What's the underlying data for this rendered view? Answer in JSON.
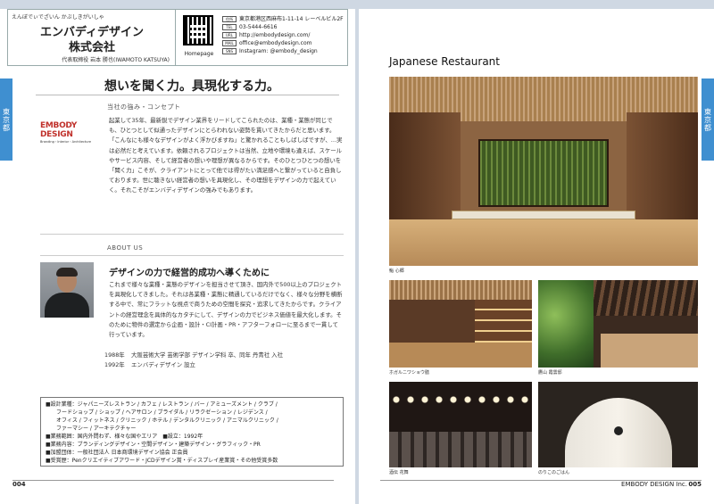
{
  "left_page": {
    "header": {
      "kana": "えんぼでぃでざいん かぶしきがいしゃ",
      "company_line1": "エンバディデザイン",
      "company_line2": "株式会社",
      "representative": "代表取締役 岩本 勝也(IWAMOTO KATSUYA)",
      "homepage_label": "Homepage",
      "contact": [
        {
          "tag": "住所",
          "value": "東京都港区西麻布1-11-14 レーベルビル2F"
        },
        {
          "tag": "TEL",
          "value": "03-5444-6616"
        },
        {
          "tag": "URL",
          "value": "http://embodydesign.com/"
        },
        {
          "tag": "MAIL",
          "value": "office@embodydesign.com"
        },
        {
          "tag": "SNS",
          "value": "Instagram: @embody_design"
        }
      ]
    },
    "side_tab": "東京都",
    "catchcopy": "想いを聞く力。具現化する力。",
    "strength_label": "当社の強み・コンセプト",
    "logo": {
      "main": "EMBODY DESIGN",
      "sub": "Branding・Interior・Architecture"
    },
    "strength_text": "起業して35年、最新鋭でデザイン業界をリードしてこられたのは、業種・業態が同じでも、ひとつとして似通ったデザインにとらわれない姿勢を貫いてきたからだと思います。「こんなにも様々なデザインがよく浮かびますね」と驚かれることもしばしばですが、…実は必然だと考えています。依頼されるプロジェクトは当然、立地や環境も違えば、スケールやサービス内容、そして経営者の想いや理想が異なるからです。そのひとつひとつの想いを「聞く力」こそが、クライアントにとって他では得がたい満足感へと繋がっていると自負しております。世に聴きない経営者の想いを具現化し、その理想をデザインの力で起えていく。それこそがエンバディデザインの強みでもあります。",
    "about_label": "ABOUT US",
    "about_heading": "デザインの力で経営的成功へ導くために",
    "about_text": "これまで様々な業種・業態のデザインを担当させて頂き、国内外で500以上のプロジェクトを具現化してきました。それは各業種・業態に精通しているだけでなく、様々な分野を横断する中で、常にフラットな視点で商うための空間を探究・追求してきたからです。クライアントの経営理念を具体的なカタチにして、デザインの力でビジネス価値を最大化します。そのために物件の選定から企画・設計・CI計画・PR・アフターフォローに至るまで一貫して行っています。",
    "career": [
      {
        "year": "1988年",
        "text": "大阪芸術大学 芸術学部 デザイン学科 卒、同年 丹青社 入社"
      },
      {
        "year": "1992年",
        "text": "エンバディデザイン 設立"
      }
    ],
    "info": [
      "■設計業種：ジャパニーズレストラン / カフェ / レストラン / バー / アミューズメント / クラブ /",
      "　　フードショップ / ショップ / ヘアサロン / ブライダル / リラクゼーション / レジデンス /",
      "　　オフィス / フィットネス / クリニック / ホテル / デンタルクリニック / アニマルクリニック /",
      "　　ファーマシー / アーキテクチャー",
      "■業務範囲：国内外問わず、様々な国やエリア　■設立：1992年",
      "■業務内容：ブランディングデザイン・空間デザイン・建築デザイン・グラフィック・PR",
      "■加盟団体：一般社団法人 日本商環境デザイン協会 正会員",
      "■受賞歴：Penクリエイティブアワード・JCDデザイン賞・ディスプレイ産業賞・その他受賞多数"
    ],
    "page_number": "004"
  },
  "right_page": {
    "side_tab": "東京都",
    "title": "Japanese Restaurant",
    "captions": {
      "main": "鮨 心郷",
      "a": "ホガルニワショウ膳",
      "b": "鷹山 霞雲邸",
      "c": "酒伝 花舞",
      "d": "のりこのごはん"
    },
    "brand": "EMBODY DESIGN Inc.",
    "page_number": "005"
  }
}
